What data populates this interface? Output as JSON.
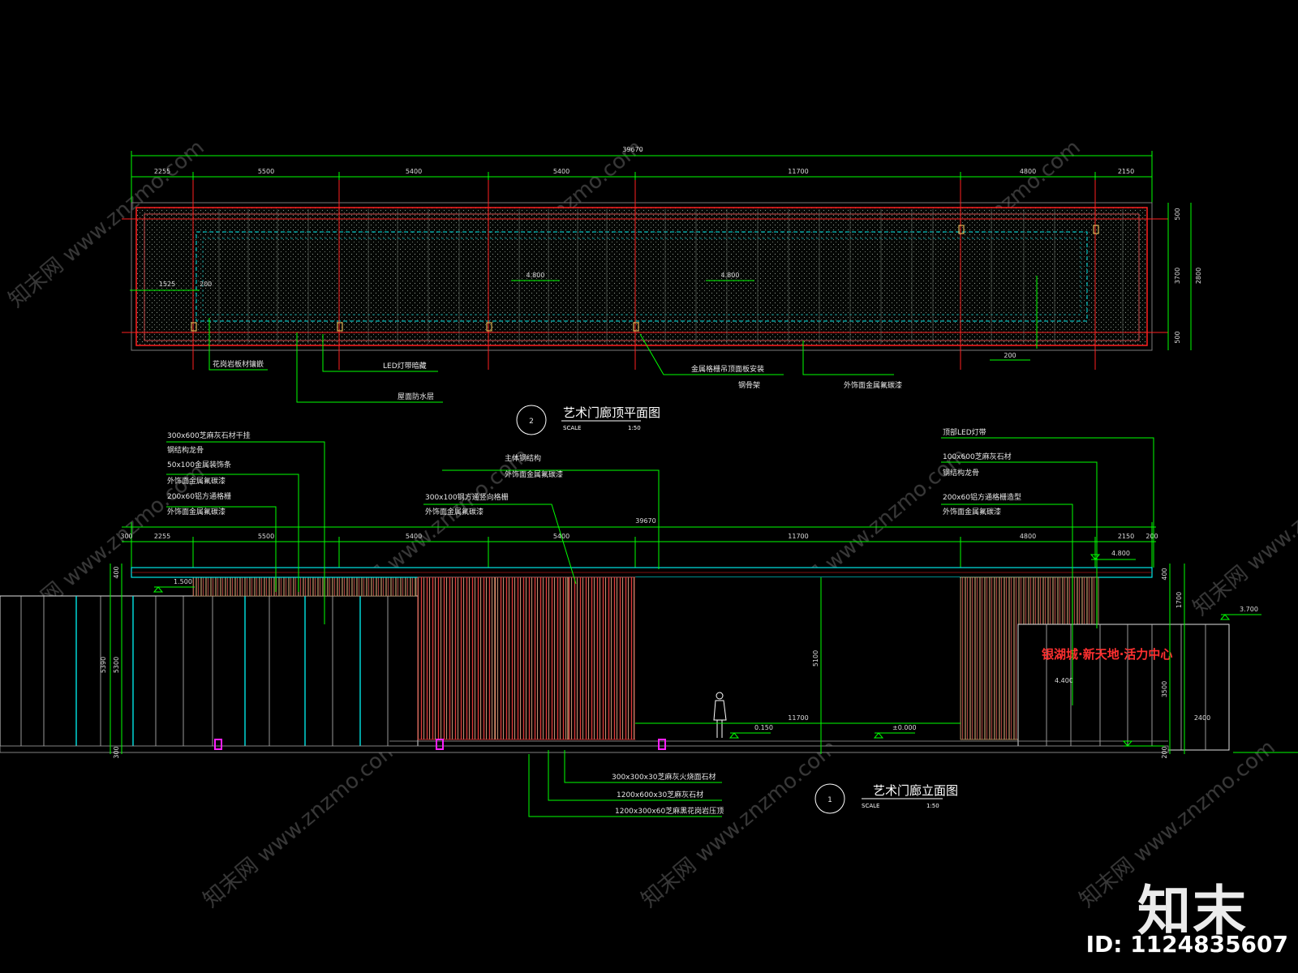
{
  "plan": {
    "title": "艺术门廊顶平面图",
    "number": "2",
    "scale_word": "SCALE",
    "scale_value": "1:50",
    "overall_dim": "39670",
    "top_dims": [
      "2255",
      "5500",
      "5400",
      "5400",
      "11700",
      "4800",
      "2150"
    ],
    "right_dims": [
      "500",
      "3700",
      "500",
      "2800"
    ],
    "left_note": "1525",
    "left_note_b": "200",
    "bottom_note": "200",
    "elev_mark": "4.800",
    "callouts": [
      "花岗岩板材镶嵌",
      "LED灯带暗藏",
      "屋面防水层",
      "金属格栅吊顶面板安装",
      "钢骨架",
      "外饰面金属氟碳漆"
    ]
  },
  "elevation": {
    "title": "艺术门廊立面图",
    "number": "1",
    "scale_word": "SCALE",
    "scale_value": "1:50",
    "overall_dim": "39670",
    "top_dims": [
      "300",
      "2255",
      "5500",
      "5400",
      "5400",
      "11700",
      "4800",
      "2150",
      "200"
    ],
    "left_dims": [
      "5390",
      "5300",
      "400",
      "300"
    ],
    "right_dims": [
      "400",
      "1700",
      "3500",
      "200"
    ],
    "center_dims": [
      "5100",
      "11700",
      "2400"
    ],
    "levels": [
      "4.800",
      "1.500",
      "4.400",
      "0.150",
      "±0.000",
      "3.700"
    ],
    "sign_text": "银湖城·新天地·活力中心",
    "callouts_left": [
      "300x600芝麻灰石材干挂",
      "钢结构龙骨",
      "50x100金属装饰条",
      "外饰面金属氟碳漆",
      "200x60铝方通格栅",
      "外饰面金属氟碳漆"
    ],
    "callouts_mid": [
      "主体钢结构",
      "外饰面金属氟碳漆",
      "300x100钢方通竖向格栅",
      "外饰面金属氟碳漆"
    ],
    "callouts_right": [
      "顶部LED灯带",
      "100x600芝麻灰石材",
      "钢结构龙骨",
      "200x60铝方通格栅造型",
      "外饰面金属氟碳漆"
    ],
    "callouts_bottom": [
      "300x300x30芝麻灰火烧面石材",
      "1200x600x30芝麻灰石材",
      "1200x300x60芝麻黑花岗岩压顶"
    ]
  },
  "colors": {
    "background": "#000000",
    "dim_green": "#00ff00",
    "axis_red": "#ff2020",
    "cyan": "#00e5e5",
    "hatch": "#9aa39a",
    "slat_red": "#e03a3a",
    "slat_brown": "#c8a070",
    "magenta": "#ff20ff",
    "sign_red": "#ff3030"
  },
  "watermark": "知末网 www.znzmo.com",
  "logo": "知末",
  "id_text": "ID: 1124835607"
}
